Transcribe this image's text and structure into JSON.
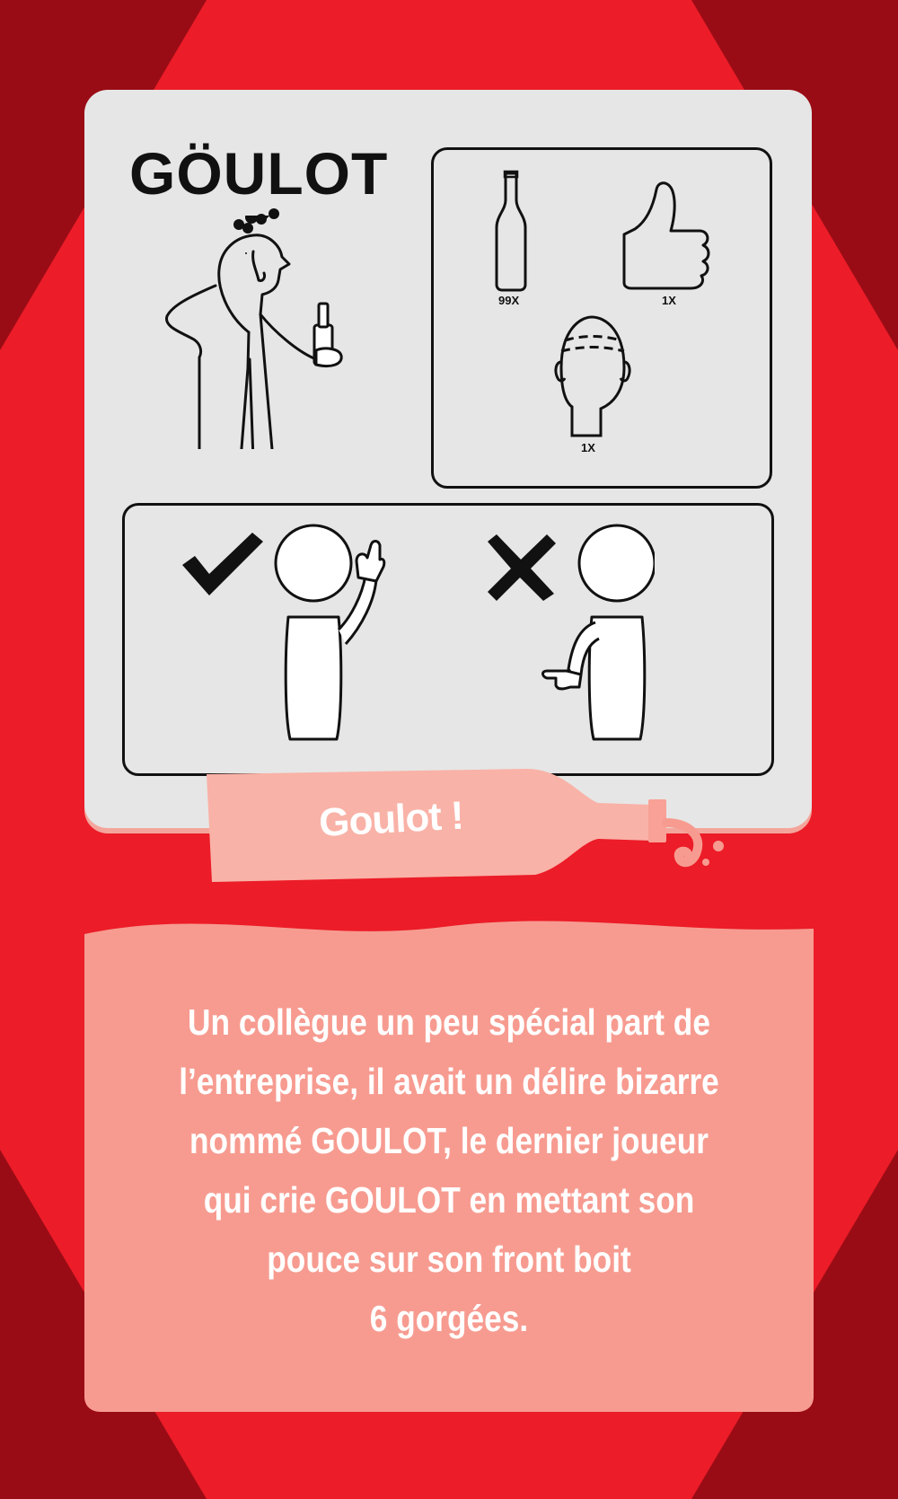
{
  "card": {
    "title": "GÖULOT",
    "bottle_label": "Goulot !",
    "items": [
      {
        "icon": "beer-bottle-icon",
        "quantity": "99X"
      },
      {
        "icon": "thumbs-up-icon",
        "quantity": "1X"
      },
      {
        "icon": "head-icon",
        "quantity": "1X"
      }
    ],
    "do_icon": "checkmark-icon",
    "dont_icon": "cross-icon",
    "description_lines": [
      "Un collègue un peu spécial part de",
      "l’entreprise, il avait un délire bizarre",
      "nommé GOULOT, le dernier joueur",
      "qui crie GOULOT en mettant son",
      "pouce sur son front boit",
      "6 gorgées."
    ]
  },
  "colors": {
    "background_dark": "#9a0c15",
    "background_red": "#ec1c28",
    "panel": "#e6e6e6",
    "bottle": "#f9b2a7",
    "text_panel": "#f79b90",
    "text": "#ffffff"
  }
}
